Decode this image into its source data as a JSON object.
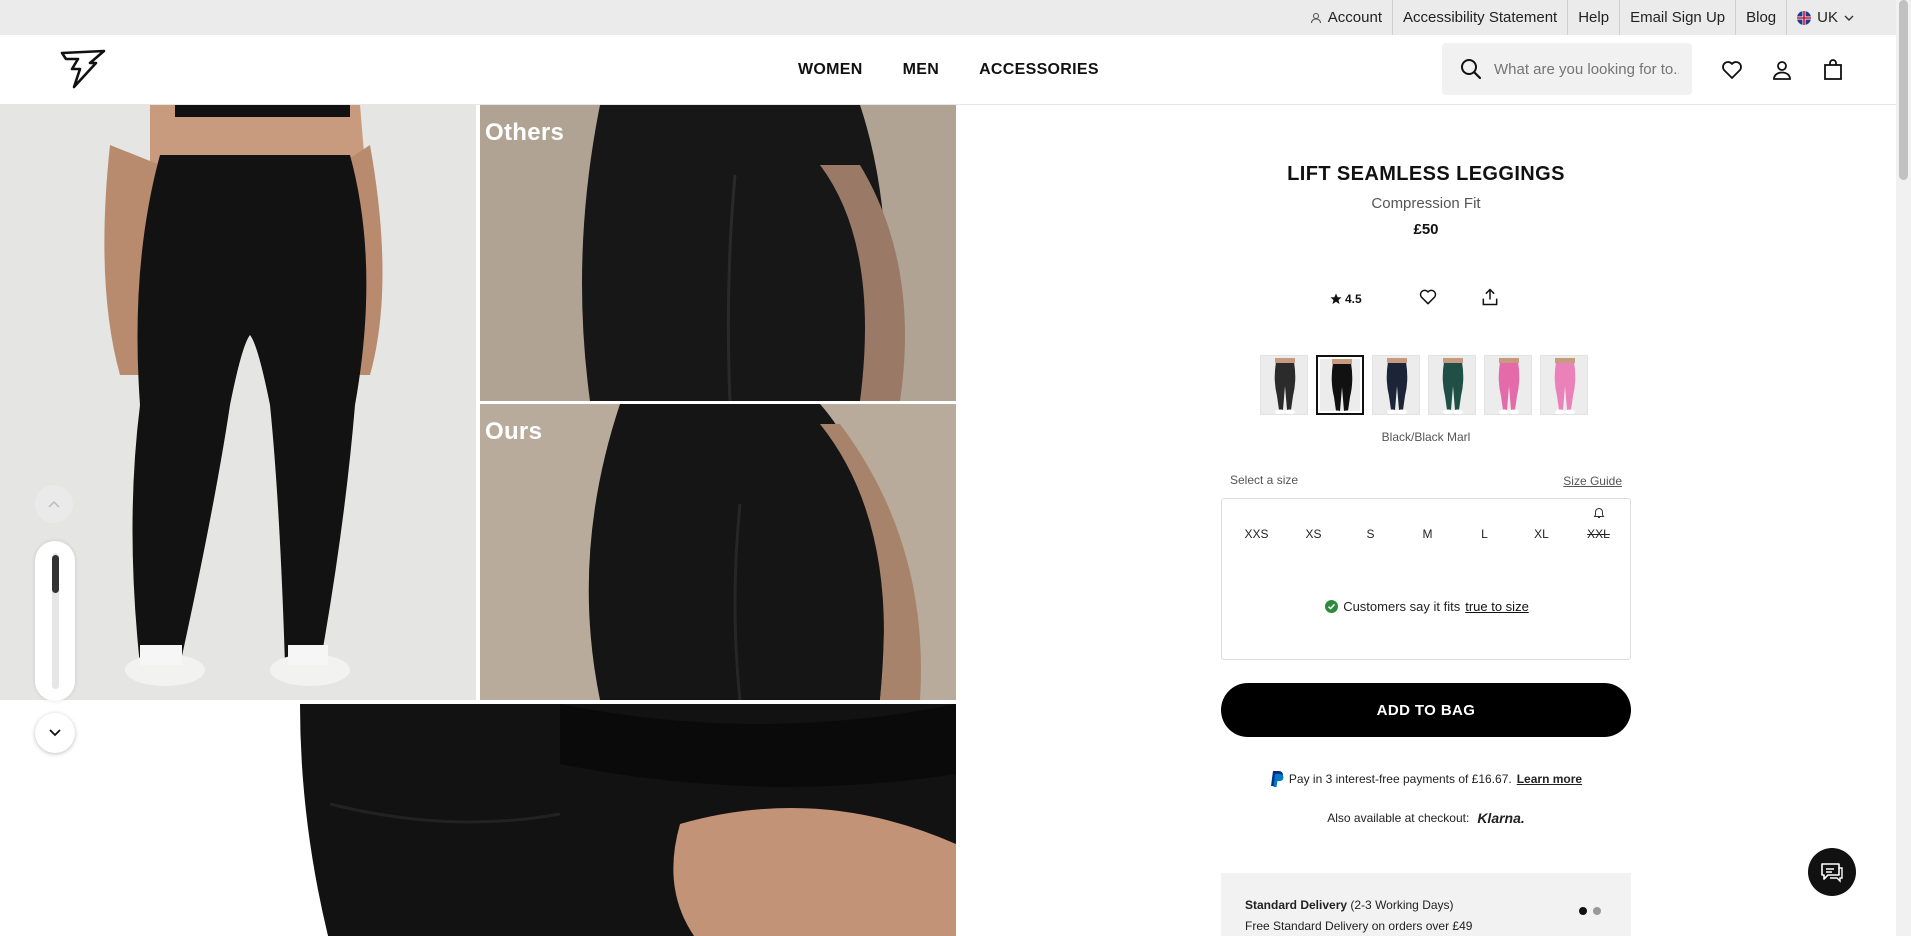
{
  "utility_bar": {
    "links": [
      "Account",
      "Accessibility Statement",
      "Help",
      "Email Sign Up",
      "Blog",
      "UK"
    ]
  },
  "header": {
    "nav": [
      "WOMEN",
      "MEN",
      "ACCESSORIES"
    ],
    "search_placeholder": "What are you looking for to..."
  },
  "gallery": {
    "label_others": "Others",
    "label_ours": "Ours"
  },
  "product": {
    "title": "LIFT SEAMLESS LEGGINGS",
    "fit": "Compression Fit",
    "price": "£50",
    "rating": "4.5",
    "selected_color": "Black/Black Marl",
    "swatch_colors": [
      "#2b2b2b",
      "#111111",
      "#1c2438",
      "#1f4f45",
      "#e46aa9",
      "#ea82b9"
    ],
    "size_label": "Select a size",
    "size_guide": "Size Guide",
    "sizes": [
      "XXS",
      "XS",
      "S",
      "M",
      "L",
      "XL",
      "XXL"
    ],
    "out_of_stock_size": "XXL",
    "fit_note_prefix": "Customers say it fits",
    "fit_note_link": "true to size",
    "add_to_bag": "ADD TO BAG",
    "paypal_text": "Pay in 3 interest-free payments of £16.67.",
    "paypal_link": "Learn more",
    "klarna_text": "Also available at checkout:",
    "klarna_logo": "Klarna.",
    "delivery_title": "Standard Delivery",
    "delivery_days": "(2-3 Working Days)",
    "delivery_sub": "Free Standard Delivery on orders over £49"
  },
  "colors": {
    "util_bg": "#ebebeb",
    "accent": "#000000",
    "fit_check": "#2e8b3e"
  }
}
